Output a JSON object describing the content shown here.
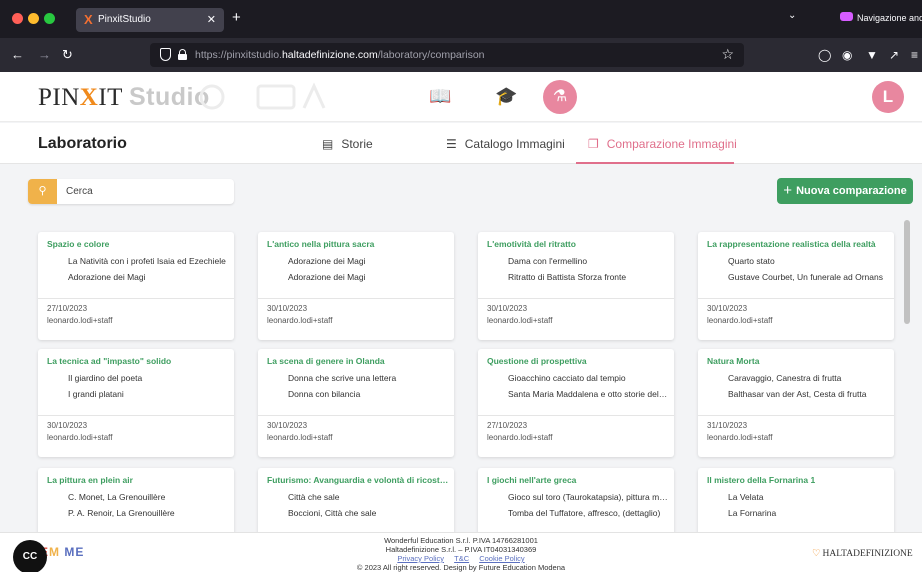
{
  "browser": {
    "tab_title": "PinxitStudio",
    "tab_favicon": "X",
    "tab_close": "✕",
    "new_tab": "+",
    "url_prefix": "https://pinxitstudio.",
    "url_domain": "haltadefinizione.com",
    "url_path": "/laboratory/comparison",
    "private_label": "Navigazione anonima",
    "icons": [
      "back-icon",
      "forward-icon",
      "reload-icon",
      "shield-icon",
      "lock-icon",
      "star-icon",
      "pocket-icon",
      "account-icon",
      "extension-icon",
      "share-icon",
      "menu-icon"
    ]
  },
  "header": {
    "logo_main_a": "PIN",
    "logo_x": "X",
    "logo_main_b": "IT",
    "logo_studio": "Studio",
    "avatar_letter": "L",
    "accent_color": "#e8879f"
  },
  "subheader": {
    "title": "Laboratorio",
    "tabs": [
      {
        "label": "Storie",
        "icon": "stories-icon"
      },
      {
        "label": "Catalogo Immagini",
        "icon": "list-icon"
      },
      {
        "label": "Comparazione Immagini",
        "icon": "compare-icon"
      }
    ],
    "active_color": "#e06f8b"
  },
  "toolbar": {
    "search_placeholder": "Cerca",
    "new_label": "Nuova comparazione",
    "new_plus": "+",
    "primary_color": "#3e9e60",
    "search_color": "#f0b24a"
  },
  "cards": [
    {
      "title": "Spazio e colore",
      "items": [
        "La Natività con i profeti Isaia ed Ezechiele",
        "Adorazione dei Magi"
      ],
      "date": "27/10/2023",
      "user": "leonardo.lodi+staff"
    },
    {
      "title": "L'antico nella pittura sacra",
      "items": [
        "Adorazione dei Magi",
        "Adorazione dei Magi"
      ],
      "date": "30/10/2023",
      "user": "leonardo.lodi+staff"
    },
    {
      "title": "L'emotività del ritratto",
      "items": [
        "Dama con l'ermellino",
        "Ritratto di Battista Sforza fronte"
      ],
      "date": "30/10/2023",
      "user": "leonardo.lodi+staff"
    },
    {
      "title": "La rappresentazione realistica della realtà",
      "items": [
        "Quarto stato",
        "Gustave Courbet, Un funerale ad Ornans"
      ],
      "date": "30/10/2023",
      "user": "leonardo.lodi+staff"
    },
    {
      "title": "La tecnica ad \"impasto\" solido",
      "items": [
        "Il giardino del poeta",
        "I grandi platani"
      ],
      "date": "30/10/2023",
      "user": "leonardo.lodi+staff"
    },
    {
      "title": "La scena di genere in Olanda",
      "items": [
        "Donna che scrive una lettera",
        "Donna con bilancia"
      ],
      "date": "30/10/2023",
      "user": "leonardo.lodi+staff"
    },
    {
      "title": "Questione di prospettiva",
      "items": [
        "Gioacchino cacciato dal tempio",
        "Santa Maria Maddalena e otto storie della sua vita"
      ],
      "date": "27/10/2023",
      "user": "leonardo.lodi+staff"
    },
    {
      "title": "Natura Morta",
      "items": [
        "Caravaggio, Canestra di frutta",
        "Balthasar van der Ast, Cesta di frutta"
      ],
      "date": "31/10/2023",
      "user": "leonardo.lodi+staff"
    },
    {
      "title": "La pittura en plein air",
      "items": [
        "C. Monet, La Grenouillère",
        "P. A. Renoir, La Grenouillère"
      ],
      "date": "",
      "user": ""
    },
    {
      "title": "Futurismo: Avanguardia e volontà di ricostruire",
      "items": [
        "Città che sale",
        "Boccioni, Città che sale"
      ],
      "date": "",
      "user": ""
    },
    {
      "title": "I giochi nell'arte greca",
      "items": [
        "Gioco sul toro (Taurokatapsia), pittura murale",
        "Tomba del Tuffatore, affresco, (dettaglio)"
      ],
      "date": "",
      "user": ""
    },
    {
      "title": "Il mistero della Fornarina 1",
      "items": [
        "La Velata",
        "La Fornarina"
      ],
      "date": "",
      "user": ""
    }
  ],
  "footer": {
    "line1": "Wonderful Education S.r.l. P.IVA 14766281001",
    "line2": "Haltadefinizione S.r.l. – P.IVA IT04031340369",
    "links": [
      "Privacy Policy",
      "T&C",
      "Cookie Policy"
    ],
    "line4": "© 2023 All right reserved. Design by Future Education Modena",
    "right_logo": "HALTADEFINIZIONE",
    "cc_label": "CC"
  }
}
